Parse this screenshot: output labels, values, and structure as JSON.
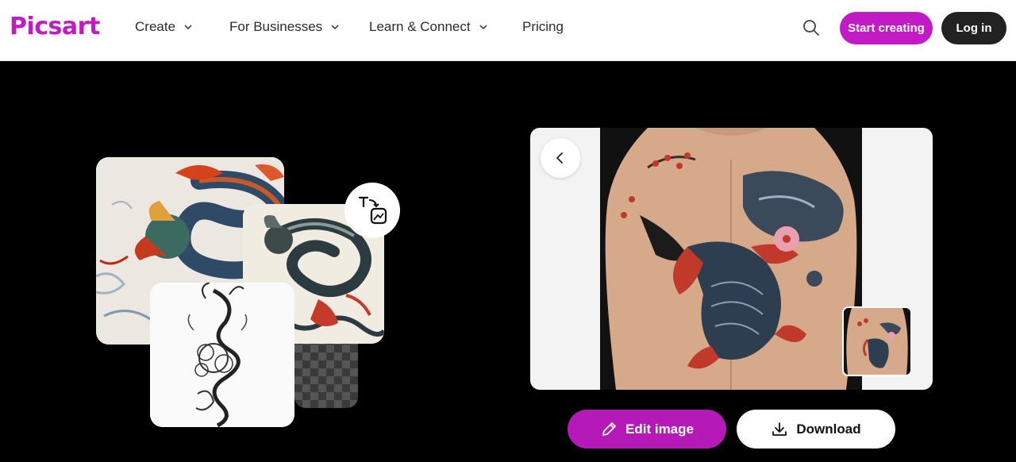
{
  "brand": {
    "logo_text": "Picsart",
    "accent": "#c21ac4"
  },
  "nav": {
    "items": [
      {
        "label": "Create",
        "has_dropdown": true
      },
      {
        "label": "For Businesses",
        "has_dropdown": true
      },
      {
        "label": "Learn & Connect",
        "has_dropdown": true
      },
      {
        "label": "Pricing",
        "has_dropdown": false
      }
    ],
    "search_icon": "search-icon",
    "start_creating_label": "Start creating",
    "login_label": "Log in"
  },
  "collage": {
    "images": [
      "color-dragon-tattoo",
      "black-grey-dragon-waves",
      "dragon-sketch",
      "transparent-checker"
    ],
    "badge_icon": "text-to-image-icon"
  },
  "preview": {
    "image": "koi-back-tattoo",
    "back_icon": "chevron-left-icon",
    "thumbnail": "koi-back-tattoo-thumbnail"
  },
  "actions": {
    "edit_label": "Edit image",
    "edit_icon": "pencil-icon",
    "download_label": "Download",
    "download_icon": "download-icon"
  }
}
